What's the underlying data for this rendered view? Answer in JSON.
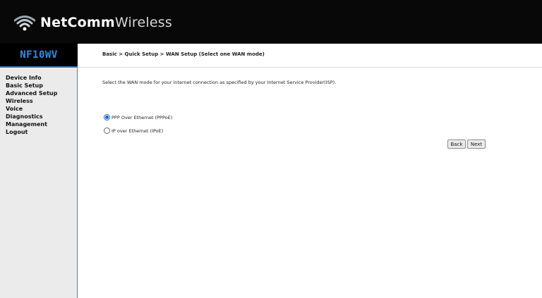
{
  "brand": {
    "name_bold": "NetComm",
    "name_light": "Wireless",
    "logo_icon": "wifi-logo-icon"
  },
  "model": "NF10WV",
  "sidebar": {
    "items": [
      {
        "label": "Device Info"
      },
      {
        "label": "Basic Setup"
      },
      {
        "label": "Advanced Setup"
      },
      {
        "label": "Wireless"
      },
      {
        "label": "Voice"
      },
      {
        "label": "Diagnostics"
      },
      {
        "label": "Management"
      },
      {
        "label": "Logout"
      }
    ]
  },
  "main": {
    "breadcrumb": "Basic > Quick Setup > WAN Setup (Select one WAN mode)",
    "instruction": "Select the WAN mode for your internet connection as specified by your Internet Service Provider(ISP).",
    "options": [
      {
        "label": "PPP Over Ethernet (PPPoE)",
        "selected": true
      },
      {
        "label": "IP over Ethernet (IPoE)",
        "selected": false
      }
    ],
    "buttons": {
      "back": "Back",
      "next": "Next"
    }
  },
  "colors": {
    "header_bg": "#080808",
    "model_text": "#2f8de4",
    "sidebar_bg": "#ebebeb",
    "accent_border": "#3a6fb0",
    "radio_selected": "#1565d8"
  }
}
